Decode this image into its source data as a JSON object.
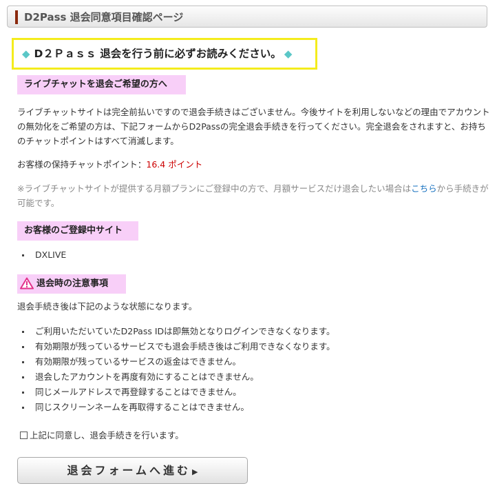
{
  "header": {
    "title": "D2Pass 退会同意項目確認ページ"
  },
  "notice": {
    "text": "D２Ｐａｓｓ 退会を行う前に必ずお読みください。"
  },
  "section_livechat": {
    "heading": "ライブチャットを退会ご希望の方へ",
    "paragraph": "ライブチャットサイトは完全前払いですので退会手続きはございません。今後サイトを利用しないなどの理由でアカウントの無効化をご希望の方は、下記フォームからD2Passの完全退会手続きを行ってください。完全退会をされますと、お持ちのチャットポイントはすべて消滅します。",
    "points_label": "お客様の保持チャットポイント：",
    "points_value": "16.4 ポイント",
    "note_before": "※ライブチャットサイトが提供する月額プランにご登録中の方で、月額サービスだけ退会したい場合は",
    "note_link": "こちら",
    "note_after": "から手続きが可能です。"
  },
  "section_sites": {
    "heading": "お客様のご登録中サイト",
    "items": [
      "DXLIVE"
    ]
  },
  "section_caution": {
    "heading": "退会時の注意事項",
    "intro": "退会手続き後は下記のような状態になります。",
    "items": [
      "ご利用いただいていたD2Pass IDは即無効となりログインできなくなります。",
      "有効期限が残っているサービスでも退会手続き後はご利用できなくなります。",
      "有効期限が残っているサービスの返金はできません。",
      "退会したアカウントを再度有効にすることはできません。",
      "同じメールアドレスで再登録することはできません。",
      "同じスクリーンネームを再取得することはできません。"
    ]
  },
  "agree": {
    "label": "上記に同意し、退会手続きを行います。",
    "checked": false
  },
  "proceed_button": {
    "label": "退会フォームへ進む"
  },
  "colors": {
    "accent": "#8b2a0e",
    "notice_border": "#f4ec1c",
    "diamond": "#5bc7c7",
    "heading_bg": "#f8cff8",
    "points": "#cc0000",
    "link": "#1a73c0",
    "warning": "#e2308a"
  }
}
